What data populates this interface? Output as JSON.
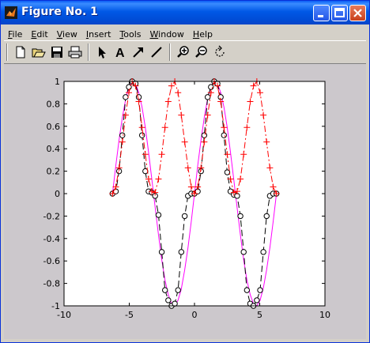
{
  "window": {
    "title": "Figure No. 1",
    "controls": [
      "minimize",
      "maximize",
      "close"
    ]
  },
  "menu": [
    "File",
    "Edit",
    "View",
    "Insert",
    "Tools",
    "Window",
    "Help"
  ],
  "toolbar": {
    "icons": [
      "new-icon",
      "open-icon",
      "save-icon",
      "print-icon",
      "arrow-icon",
      "text-icon",
      "line-arrow-icon",
      "line-icon",
      "zoom-in-icon",
      "zoom-out-icon",
      "rotate-icon"
    ],
    "text_tool_label": "A"
  },
  "colors": {
    "titlebar": "#0054e3",
    "figure_bg": "#ccc8cc",
    "axes_bg": "#ffffff",
    "series_magenta": "#ff00ff",
    "series_red": "#ff0000",
    "series_black": "#000000"
  },
  "chart_data": {
    "type": "line",
    "title": "",
    "xlabel": "",
    "ylabel": "",
    "xlim": [
      -10,
      10
    ],
    "ylim": [
      -1,
      1
    ],
    "xticks": [
      -10,
      -5,
      0,
      5,
      10
    ],
    "xtick_labels": [
      "-10",
      "-5",
      "0",
      "5",
      "10"
    ],
    "yticks": [
      -1,
      -0.8,
      -0.6,
      -0.4,
      -0.2,
      0,
      0.2,
      0.4,
      0.6,
      0.8,
      1
    ],
    "ytick_labels": [
      "-1",
      "-0.8",
      "-0.6",
      "-0.4",
      "-0.2",
      "0",
      "0.2",
      "0.4",
      "0.6",
      "0.8",
      "1"
    ],
    "grid": false,
    "legend": false,
    "series": [
      {
        "color": "#ff00ff",
        "line": "solid",
        "marker": "none",
        "x": [
          -6.283,
          -6.03,
          -5.78,
          -5.53,
          -5.28,
          -5.03,
          -4.78,
          -4.52,
          -4.27,
          -4.02,
          -3.77,
          -3.52,
          -3.27,
          -3.02,
          -2.76,
          -2.51,
          -2.26,
          -2.01,
          -1.76,
          -1.51,
          -1.26,
          -1.01,
          -0.75,
          -0.5,
          -0.25,
          0,
          0.25,
          0.5,
          0.75,
          1.01,
          1.26,
          1.51,
          1.76,
          2.01,
          2.26,
          2.51,
          2.76,
          3.02,
          3.27,
          3.52,
          3.77,
          4.02,
          4.27,
          4.52,
          4.78,
          5.03,
          5.28,
          5.53,
          5.78,
          6.03,
          6.283
        ],
        "y": [
          0,
          0.25,
          0.48,
          0.68,
          0.84,
          0.95,
          1,
          0.98,
          0.9,
          0.77,
          0.59,
          0.37,
          0.13,
          -0.12,
          -0.37,
          -0.59,
          -0.77,
          -0.9,
          -0.98,
          -1,
          -0.95,
          -0.85,
          -0.68,
          -0.48,
          -0.25,
          0,
          0.25,
          0.48,
          0.68,
          0.85,
          0.95,
          1,
          0.98,
          0.9,
          0.77,
          0.59,
          0.37,
          0.12,
          -0.13,
          -0.37,
          -0.59,
          -0.77,
          -0.9,
          -0.98,
          -1,
          -0.95,
          -0.84,
          -0.68,
          -0.48,
          -0.25,
          0
        ]
      },
      {
        "color": "#000000",
        "line": "dashed",
        "marker": "circle",
        "x": [
          -6.283,
          -6.03,
          -5.78,
          -5.53,
          -5.28,
          -5.03,
          -4.78,
          -4.52,
          -4.27,
          -4.02,
          -3.77,
          -3.52,
          -3.27,
          -3.02,
          -2.76,
          -2.51,
          -2.26,
          -2.01,
          -1.76,
          -1.51,
          -1.26,
          -1.01,
          -0.75,
          -0.5,
          -0.25,
          0,
          0.25,
          0.5,
          0.75,
          1.01,
          1.26,
          1.51,
          1.76,
          2.01,
          2.26,
          2.51,
          2.76,
          3.02,
          3.27,
          3.52,
          3.77,
          4.02,
          4.27,
          4.52,
          4.78,
          5.03,
          5.28,
          5.53,
          5.78,
          6.03,
          6.283
        ],
        "y": [
          0,
          0.02,
          0.2,
          0.52,
          0.86,
          0.95,
          1,
          0.98,
          0.86,
          0.52,
          0.2,
          0.02,
          0.01,
          -0.02,
          -0.19,
          -0.52,
          -0.86,
          -0.95,
          -1,
          -0.98,
          -0.86,
          -0.52,
          -0.2,
          -0.02,
          0,
          0,
          0.02,
          0.2,
          0.52,
          0.86,
          0.95,
          1,
          0.98,
          0.86,
          0.52,
          0.19,
          0.02,
          -0.01,
          -0.02,
          -0.2,
          -0.52,
          -0.86,
          -0.98,
          -1,
          -0.95,
          -0.86,
          -0.52,
          -0.2,
          -0.02,
          0,
          0
        ]
      },
      {
        "color": "#ff0000",
        "line": "dashdot",
        "marker": "plus",
        "x": [
          -6.283,
          -6.03,
          -5.78,
          -5.53,
          -5.28,
          -5.03,
          -4.78,
          -4.52,
          -4.27,
          -4.02,
          -3.77,
          -3.52,
          -3.27,
          -3.02,
          -2.76,
          -2.51,
          -2.26,
          -2.01,
          -1.76,
          -1.51,
          -1.26,
          -1.01,
          -0.75,
          -0.5,
          -0.25,
          0,
          0.25,
          0.5,
          0.75,
          1.01,
          1.26,
          1.51,
          1.76,
          2.01,
          2.26,
          2.51,
          2.76,
          3.02,
          3.27,
          3.52,
          3.77,
          4.02,
          4.27,
          4.52,
          4.78,
          5.03,
          5.28,
          5.53,
          5.78,
          6.03,
          6.283
        ],
        "y": [
          0,
          0.06,
          0.23,
          0.46,
          0.7,
          0.9,
          1,
          0.96,
          0.82,
          0.59,
          0.35,
          0.13,
          0.02,
          0.01,
          0.13,
          0.35,
          0.59,
          0.82,
          0.96,
          1,
          0.9,
          0.7,
          0.46,
          0.23,
          0.06,
          0,
          0.06,
          0.23,
          0.46,
          0.7,
          0.9,
          1,
          0.96,
          0.82,
          0.59,
          0.35,
          0.13,
          0.01,
          0.02,
          0.13,
          0.35,
          0.59,
          0.82,
          0.96,
          1,
          0.9,
          0.7,
          0.46,
          0.23,
          0.06,
          0
        ]
      }
    ]
  }
}
